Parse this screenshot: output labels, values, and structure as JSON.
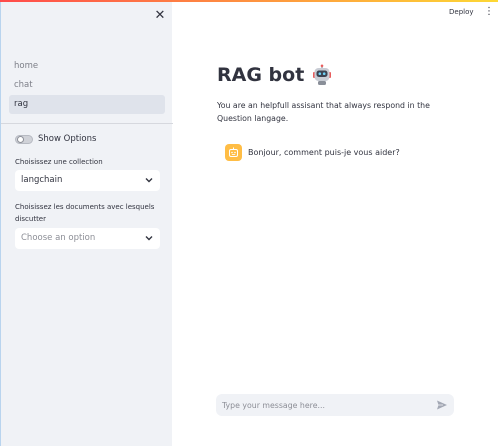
{
  "sidebar": {
    "close_symbol": "✕",
    "nav": [
      {
        "label": "home",
        "active": false
      },
      {
        "label": "chat",
        "active": false
      },
      {
        "label": "rag",
        "active": true
      }
    ],
    "toggle_label": "Show Options",
    "collection_label": "Choisissez une collection",
    "collection_value": "langchain",
    "documents_label": "Choisissez les documents avec lesquels discutter",
    "documents_placeholder": "Choose an option"
  },
  "header": {
    "deploy_label": "Deploy",
    "menu_symbol": "⋮"
  },
  "main": {
    "title": "RAG bot",
    "description": "You are an helpfull assisant that always respond in the Question langage.",
    "message": "Bonjour, comment puis-je vous aider?",
    "input_placeholder": "Type your message here..."
  },
  "icons": {
    "title_icon": "robot-icon",
    "avatar_icon": "bot-avatar-icon",
    "send_icon": "send-icon",
    "chevron": "chevron-down-icon"
  },
  "colors": {
    "sidebar_bg": "#f0f2f6",
    "avatar_bg": "#ffbd45",
    "active_nav_bg": "#dfe3eb"
  }
}
